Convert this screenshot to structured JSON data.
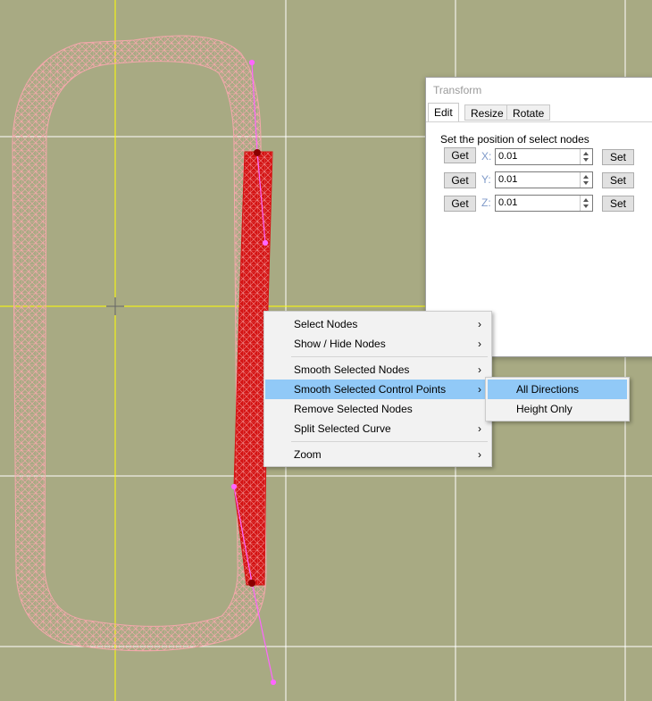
{
  "transform_panel": {
    "title": "Transform",
    "tabs": [
      "Edit",
      "Resize",
      "Rotate"
    ],
    "active_tab": "Edit",
    "caption": "Set the position of select nodes",
    "get_label": "Get",
    "set_label": "Set",
    "fields": [
      {
        "axis": "X:",
        "value": "0.01"
      },
      {
        "axis": "Y:",
        "value": "0.01"
      },
      {
        "axis": "Z:",
        "value": "0.01"
      }
    ]
  },
  "context_menu": {
    "items": [
      {
        "label": "Select Nodes",
        "arrow": "›"
      },
      {
        "label": "Show / Hide Nodes",
        "arrow": "›"
      },
      {
        "label": "Smooth Selected Nodes",
        "arrow": "›"
      },
      {
        "label": "Smooth Selected Control Points",
        "arrow": "›",
        "highlighted": true
      },
      {
        "label": "Remove Selected Nodes",
        "arrow": ""
      },
      {
        "label": "Split Selected Curve",
        "arrow": "›"
      },
      {
        "label": "Zoom",
        "arrow": "›"
      }
    ],
    "submenu": [
      {
        "label": "All Directions",
        "highlighted": true
      },
      {
        "label": "Height Only"
      }
    ]
  },
  "colors": {
    "background": "#a8aa83",
    "grid": "#ffffff",
    "axis": "#ffff00",
    "track_mesh": "#f4a8ac",
    "selected_mesh": "#d41414",
    "control_line": "#ff66ff",
    "highlight": "#91c9f7"
  }
}
